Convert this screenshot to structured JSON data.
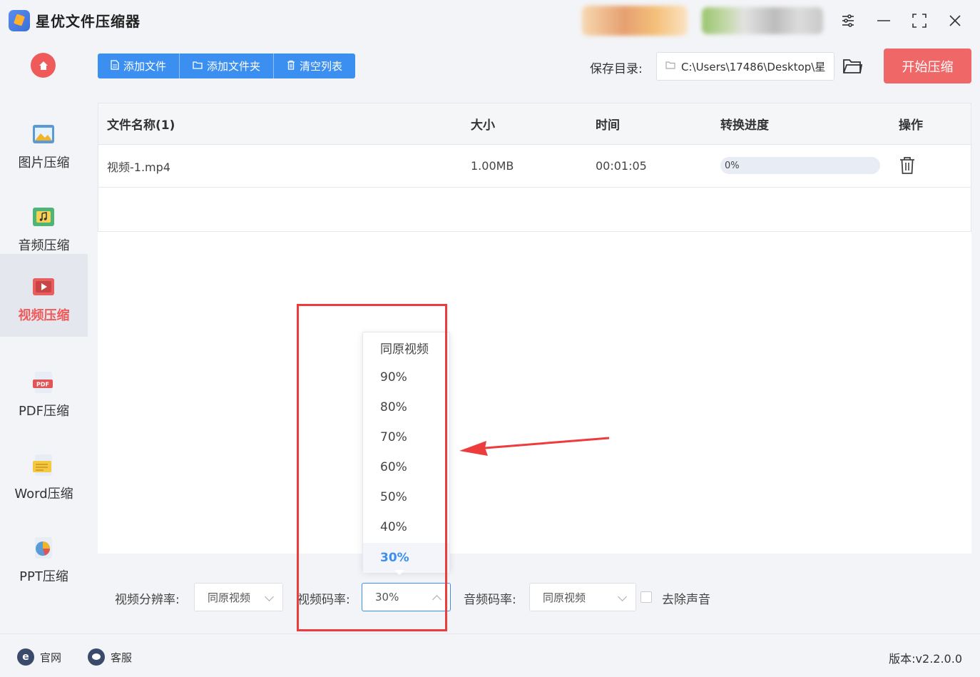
{
  "app": {
    "title": "星优文件压缩器"
  },
  "sidebar": {
    "items": [
      {
        "label": "图片压缩",
        "icon": "image-icon"
      },
      {
        "label": "音频压缩",
        "icon": "audio-icon"
      },
      {
        "label": "视频压缩",
        "icon": "video-icon",
        "active": true
      },
      {
        "label": "PDF压缩",
        "icon": "pdf-icon"
      },
      {
        "label": "Word压缩",
        "icon": "word-icon"
      },
      {
        "label": "PPT压缩",
        "icon": "ppt-icon"
      }
    ]
  },
  "toolbar": {
    "add_file": "添加文件",
    "add_folder": "添加文件夹",
    "clear_list": "清空列表",
    "save_label": "保存目录:",
    "save_path": "C:\\Users\\17486\\Desktop\\星",
    "start": "开始压缩"
  },
  "table": {
    "headers": [
      "文件名称(1)",
      "大小",
      "时间",
      "转换进度",
      "操作"
    ],
    "rows": [
      {
        "name": "视频-1.mp4",
        "size": "1.00MB",
        "time": "00:01:05",
        "progress": "0%",
        "progress_value": 0
      }
    ]
  },
  "settings": {
    "resolution_label": "视频分辨率:",
    "resolution_value": "同原视频",
    "bitrate_label": "视频码率:",
    "bitrate_value": "30%",
    "audio_label": "音频码率:",
    "audio_value": "同原视频",
    "mute_label": "去除声音"
  },
  "dropdown": {
    "options": [
      "同原视频",
      "90%",
      "80%",
      "70%",
      "60%",
      "50%",
      "40%",
      "30%"
    ],
    "selected": "30%"
  },
  "footer": {
    "website": "官网",
    "support": "客服",
    "version": "版本:v2.2.0.0"
  },
  "colors": {
    "accent": "#3b8ff0",
    "danger": "#ef6767",
    "highlight": "#ee3b3b"
  }
}
